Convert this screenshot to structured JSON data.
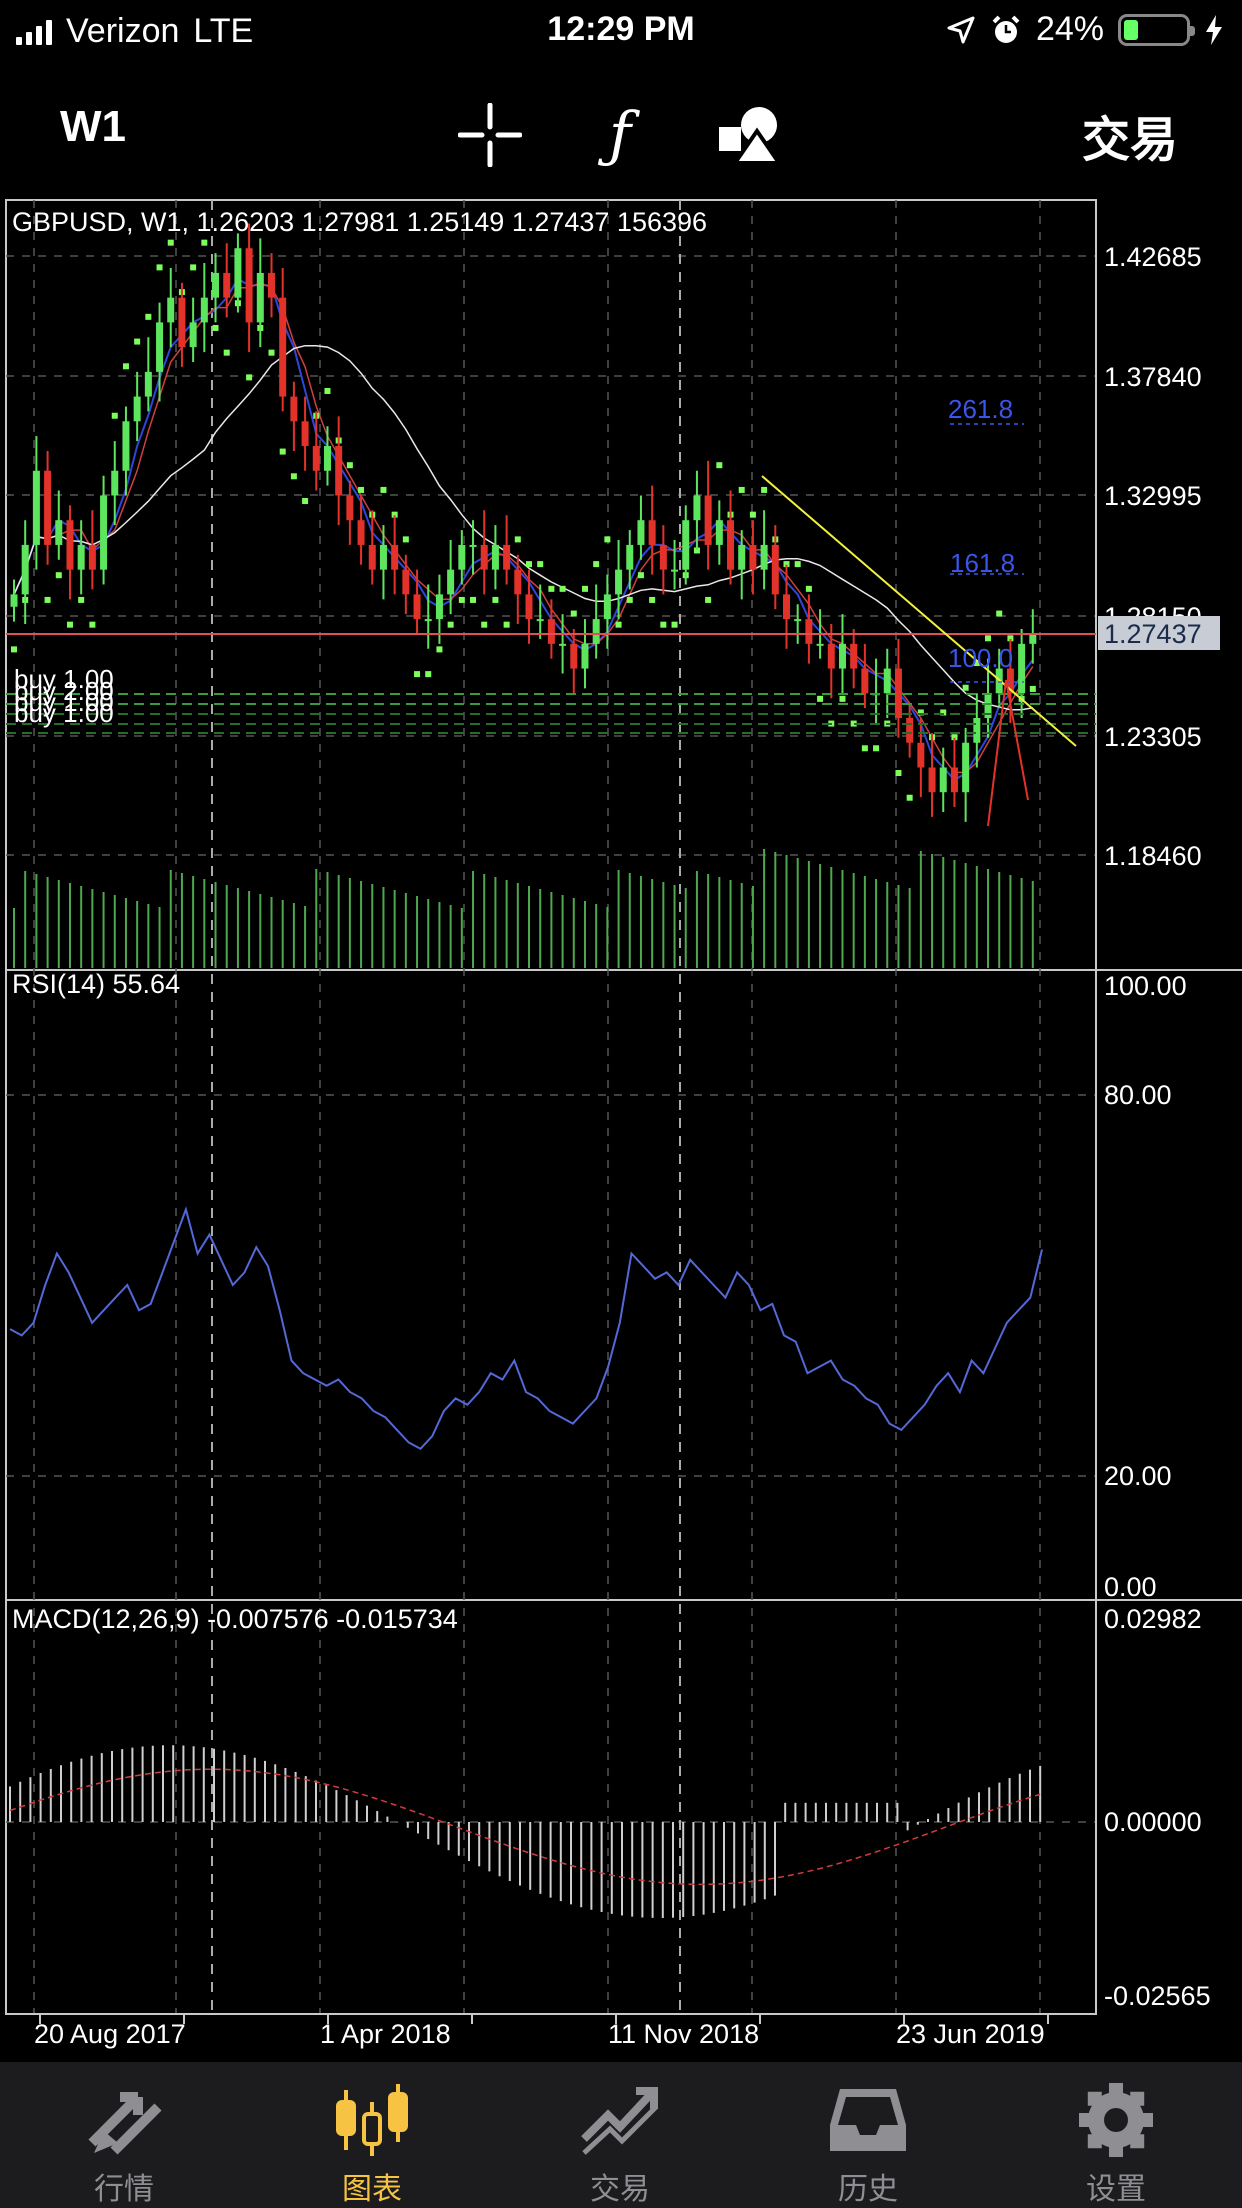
{
  "status_bar": {
    "carrier": "Verizon",
    "network": "LTE",
    "time": "12:29 PM",
    "battery": "24%",
    "battery_level": 0.24,
    "icons": [
      "signal-icon",
      "location-arrow-icon",
      "alarm-icon",
      "battery-icon",
      "charging-bolt-icon"
    ]
  },
  "toolbar": {
    "timeframe": "W1",
    "tools": [
      "crosshair-icon",
      "function-icon",
      "shapes-icon"
    ],
    "trade_label": "交易"
  },
  "chart": {
    "header": "GBPUSD, W1, 1.26203 1.27981 1.25149 1.27437 156396",
    "price_axis": [
      "1.42685",
      "1.37840",
      "1.32995",
      "1.28150",
      "1.23305",
      "1.18460"
    ],
    "current_price": "1.27437",
    "fib_levels": [
      "261.8",
      "161.8",
      "100.0"
    ],
    "order_labels": [
      "buy 1.00",
      "buy 2.00",
      "buy 1.00",
      "buy 1.00"
    ],
    "rsi_header": "RSI(14) 55.64",
    "rsi_axis": [
      "100.00",
      "80.00",
      "20.00",
      "0.00"
    ],
    "macd_header": "MACD(12,26,9) -0.007576 -0.015734",
    "macd_axis": [
      "0.02982",
      "0.00000",
      "-0.02565"
    ],
    "date_axis": [
      "20 Aug 2017",
      "1 Apr 2018",
      "11 Nov 2018",
      "23 Jun 2019"
    ],
    "colors": {
      "bull": "#5ee55e",
      "bear": "#e2322a",
      "price_line": "#e05050",
      "ma_fast": "#3046d8",
      "ma_slow": "#e8e8e8",
      "sar": "#7cff5c",
      "trend": "#f0f040",
      "fib": "#3a55e8"
    }
  },
  "tabs": [
    {
      "label": "行情",
      "icon": "quotes-arrows-icon",
      "active": false
    },
    {
      "label": "图表",
      "icon": "chart-candles-icon",
      "active": true
    },
    {
      "label": "交易",
      "icon": "trade-trend-icon",
      "active": false
    },
    {
      "label": "历史",
      "icon": "history-inbox-icon",
      "active": false
    },
    {
      "label": "设置",
      "icon": "settings-gear-icon",
      "active": false
    }
  ]
}
